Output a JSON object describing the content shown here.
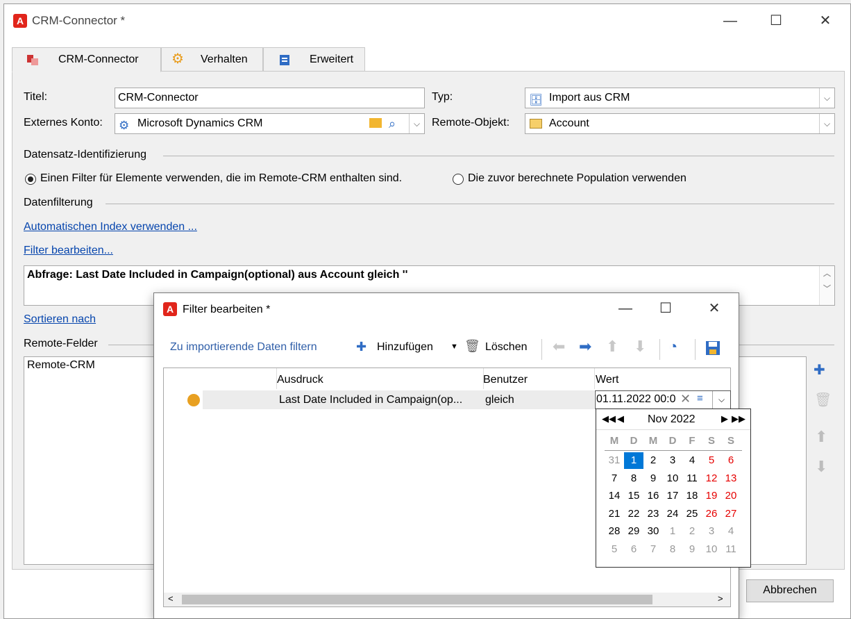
{
  "window": {
    "title": "CRM-Connector *",
    "controls": {
      "minimize": "—",
      "maximize": "☐",
      "close": "✕"
    }
  },
  "tabs": [
    {
      "label": "CRM-Connector",
      "icon": "crm-icon"
    },
    {
      "label": "Verhalten",
      "icon": "gears-icon"
    },
    {
      "label": "Erweitert",
      "icon": "clipboard-icon"
    }
  ],
  "form": {
    "title_label": "Titel:",
    "title_value": "CRM-Connector",
    "type_label": "Typ:",
    "type_value": "Import aus CRM",
    "account_label": "Externes Konto:",
    "account_value": "Microsoft Dynamics CRM",
    "remote_object_label": "Remote-Objekt:",
    "remote_object_value": "Account"
  },
  "record_identification": {
    "heading": "Datensatz-Identifizierung",
    "option1": "Einen Filter für Elemente verwenden, die im Remote-CRM enthalten sind.",
    "option2": "Die zuvor berechnete Population verwenden"
  },
  "data_filter": {
    "heading": "Datenfilterung",
    "auto_index_link": "Automatischen Index verwenden ...",
    "edit_filter_link": "Filter bearbeiten...",
    "query_text": "Abfrage: Last Date Included in Campaign(optional) aus Account gleich ''"
  },
  "sort_link": "Sortieren nach",
  "remote_fields": {
    "heading": "Remote-Felder",
    "list_item": "Remote-CRM"
  },
  "cancel_button": "Abbrechen",
  "dialog": {
    "title": "Filter bearbeiten *",
    "toolbar": {
      "filter_label": "Zu importierende Daten filtern",
      "add_label": "Hinzufügen",
      "delete_label": "Löschen"
    },
    "columns": [
      "Ausdruck",
      "Benutzer",
      "Wert"
    ],
    "row": {
      "expression": "Last Date Included in Campaign(op...",
      "operator": "gleich",
      "value": "01.11.2022 00:0"
    },
    "calendar": {
      "month_label": "Nov 2022",
      "weekdays": [
        "M",
        "D",
        "M",
        "D",
        "F",
        "S",
        "S"
      ],
      "weeks": [
        [
          "31",
          "1",
          "2",
          "3",
          "4",
          "5",
          "6"
        ],
        [
          "7",
          "8",
          "9",
          "10",
          "11",
          "12",
          "13"
        ],
        [
          "14",
          "15",
          "16",
          "17",
          "18",
          "19",
          "20"
        ],
        [
          "21",
          "22",
          "23",
          "24",
          "25",
          "26",
          "27"
        ],
        [
          "28",
          "29",
          "30",
          "1",
          "2",
          "3",
          "4"
        ],
        [
          "5",
          "6",
          "7",
          "8",
          "9",
          "10",
          "11"
        ]
      ],
      "selected_day": "1",
      "colors": {
        "weekend": "#e60000",
        "other_month": "#999999",
        "selected_bg": "#0078d7"
      }
    }
  }
}
